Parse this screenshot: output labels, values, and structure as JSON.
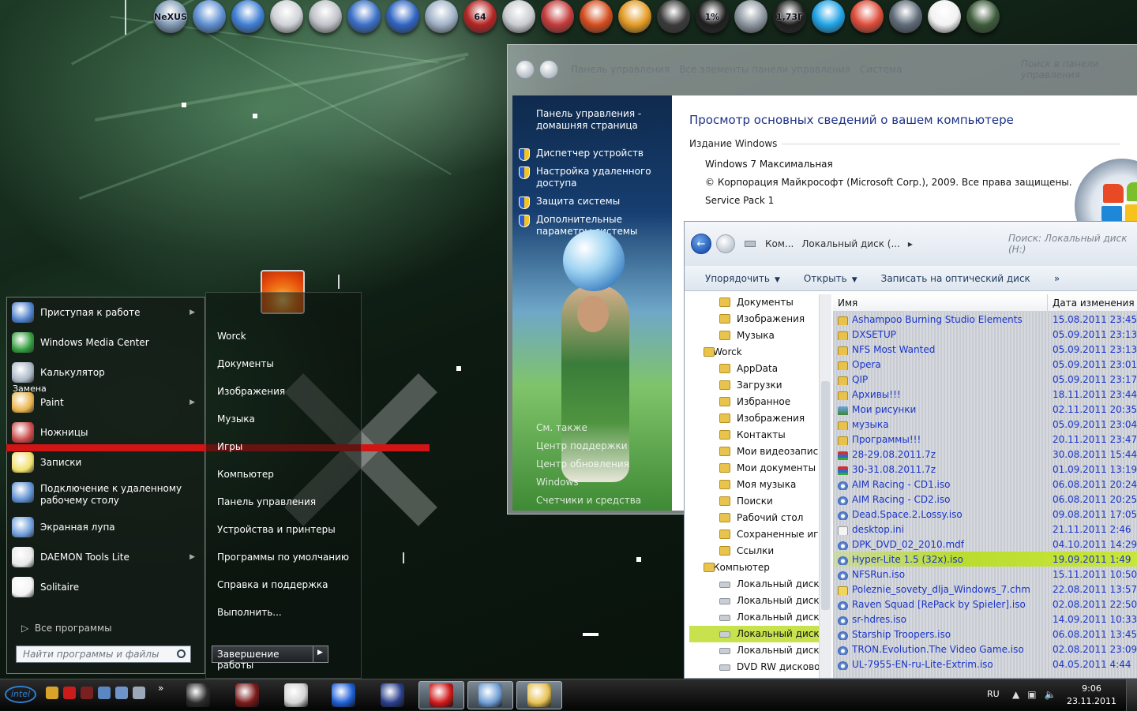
{
  "dock": {
    "items": [
      {
        "name": "nexus-icon",
        "label": "NeXUS",
        "color": "#7f9ab5"
      },
      {
        "name": "computer-icon",
        "label": "",
        "color": "#5d8fd1"
      },
      {
        "name": "windows-flag-icon",
        "label": "",
        "color": "#3f7fd4"
      },
      {
        "name": "alien-mask-icon",
        "label": "",
        "color": "#cfd2d6"
      },
      {
        "name": "clock-icon",
        "label": "",
        "color": "#bfc3c8"
      },
      {
        "name": "x-app-icon",
        "label": "",
        "color": "#3a6fc7"
      },
      {
        "name": "lightning-icon",
        "label": "",
        "color": "#2f64c2"
      },
      {
        "name": "recycle-bin-icon",
        "label": "",
        "color": "#9fb1c6"
      },
      {
        "name": "aida64-icon",
        "label": "64",
        "color": "#b52424"
      },
      {
        "name": "printer-icon",
        "label": "",
        "color": "#c9ccd0"
      },
      {
        "name": "tools-icon",
        "label": "",
        "color": "#c43a3a"
      },
      {
        "name": "ccleaner-icon",
        "label": "",
        "color": "#d44c1d"
      },
      {
        "name": "gear-icon",
        "label": "",
        "color": "#e39a22"
      },
      {
        "name": "film-reel-icon",
        "label": "",
        "color": "#3a3a3a"
      },
      {
        "name": "cpu-meter-icon",
        "label": "1%",
        "color": "#1e1e1e"
      },
      {
        "name": "network-icon",
        "label": "",
        "color": "#8c959e"
      },
      {
        "name": "memory-meter-icon",
        "label": "1,73Г",
        "color": "#1e1e1e"
      },
      {
        "name": "skype-icon",
        "label": "",
        "color": "#1fa3e6"
      },
      {
        "name": "chrome-icon",
        "label": "",
        "color": "#dd4b39"
      },
      {
        "name": "globe-icon",
        "label": "",
        "color": "#5e6a78"
      },
      {
        "name": "document-icon",
        "label": "",
        "color": "#f2f2f2"
      },
      {
        "name": "camera-icon",
        "label": "",
        "color": "#3c5a3a"
      }
    ]
  },
  "control_panel": {
    "breadcrumb": [
      "Панель управления",
      "Все элементы панели управления",
      "Система"
    ],
    "search_placeholder": "Поиск в панели управления",
    "sidebar": {
      "home": "Панель управления - домашняя страница",
      "links": [
        "Диспетчер устройств",
        "Настройка удаленного доступа",
        "Защита системы",
        "Дополнительные параметры системы"
      ],
      "see_also": [
        "См. также",
        "Центр поддержки",
        "Центр обновления Windows",
        "Счетчики и средства производительности"
      ]
    },
    "heading": "Просмотр основных сведений о вашем компьютере",
    "edition_section": "Издание Windows",
    "edition_lines": [
      "Windows 7 Максимальная",
      "© Корпорация Майкрософт (Microsoft Corp.), 2009. Все права защищены.",
      "Service Pack 1"
    ]
  },
  "explorer": {
    "address": [
      "Ком...",
      "Локальный диск (...",
      ""
    ],
    "search_placeholder": "Поиск: Локальный диск (H:)",
    "toolbar": {
      "organize": "Упорядочить",
      "open": "Открыть",
      "burn": "Записать на оптический диск"
    },
    "columns": {
      "name": "Имя",
      "date": "Дата изменения"
    },
    "tree": [
      {
        "label": "Документы",
        "level": 1,
        "type": "folder"
      },
      {
        "label": "Изображения",
        "level": 1,
        "type": "folder"
      },
      {
        "label": "Музыка",
        "level": 1,
        "type": "folder"
      },
      {
        "label": "Worck",
        "level": 0,
        "type": "folder"
      },
      {
        "label": "AppData",
        "level": 1,
        "type": "folder"
      },
      {
        "label": "Загрузки",
        "level": 1,
        "type": "folder"
      },
      {
        "label": "Избранное",
        "level": 1,
        "type": "folder"
      },
      {
        "label": "Изображения",
        "level": 1,
        "type": "folder"
      },
      {
        "label": "Контакты",
        "level": 1,
        "type": "folder"
      },
      {
        "label": "Мои видеозаписи",
        "level": 1,
        "type": "folder"
      },
      {
        "label": "Мои документы",
        "level": 1,
        "type": "folder"
      },
      {
        "label": "Моя музыка",
        "level": 1,
        "type": "folder"
      },
      {
        "label": "Поиски",
        "level": 1,
        "type": "folder"
      },
      {
        "label": "Рабочий стол",
        "level": 1,
        "type": "folder"
      },
      {
        "label": "Сохраненные игры",
        "level": 1,
        "type": "folder"
      },
      {
        "label": "Ссылки",
        "level": 1,
        "type": "folder"
      },
      {
        "label": "Компьютер",
        "level": 0,
        "type": "computer"
      },
      {
        "label": "Локальный диск (C:)",
        "level": 1,
        "type": "drive"
      },
      {
        "label": "Локальный диск (D:)",
        "level": 1,
        "type": "drive"
      },
      {
        "label": "Локальный диск (E:)",
        "level": 1,
        "type": "drive"
      },
      {
        "label": "Локальный диск (H:)",
        "level": 1,
        "type": "drive",
        "selected": true
      },
      {
        "label": "Локальный диск (G:)",
        "level": 1,
        "type": "drive"
      },
      {
        "label": "DVD RW дисковод",
        "level": 1,
        "type": "drive"
      }
    ],
    "files": [
      {
        "name": "Ashampoo Burning Studio Elements",
        "date": "15.08.2011 23:45",
        "type": "folder"
      },
      {
        "name": "DXSETUP",
        "date": "05.09.2011 23:13",
        "type": "folder"
      },
      {
        "name": "NFS Most Wanted",
        "date": "05.09.2011 23:13",
        "type": "folder"
      },
      {
        "name": "Opera",
        "date": "05.09.2011 23:01",
        "type": "folder"
      },
      {
        "name": "QIP",
        "date": "05.09.2011 23:17",
        "type": "folder"
      },
      {
        "name": "Архивы!!!",
        "date": "18.11.2011 23:44",
        "type": "folder"
      },
      {
        "name": "Мои рисунки",
        "date": "02.11.2011 20:35",
        "type": "img"
      },
      {
        "name": "музыка",
        "date": "05.09.2011 23:04",
        "type": "folder"
      },
      {
        "name": "Программы!!!",
        "date": "20.11.2011 23:47",
        "type": "folder"
      },
      {
        "name": "28-29.08.2011.7z",
        "date": "30.08.2011 15:44",
        "type": "archive"
      },
      {
        "name": "30-31.08.2011.7z",
        "date": "01.09.2011 13:19",
        "type": "archive"
      },
      {
        "name": "AIM Racing - CD1.iso",
        "date": "06.08.2011 20:24",
        "type": "iso"
      },
      {
        "name": "AIM Racing - CD2.iso",
        "date": "06.08.2011 20:25",
        "type": "iso"
      },
      {
        "name": "Dead.Space.2.Lossy.iso",
        "date": "09.08.2011 17:05",
        "type": "iso"
      },
      {
        "name": "desktop.ini",
        "date": "21.11.2011 2:46",
        "type": "doc"
      },
      {
        "name": "DPK_DVD_02_2010.mdf",
        "date": "04.10.2011 14:29",
        "type": "iso"
      },
      {
        "name": "Hyper-Lite 1.5 (32x).iso",
        "date": "19.09.2011 1:49",
        "type": "iso",
        "highlight": true
      },
      {
        "name": "NFSRun.iso",
        "date": "15.11.2011 10:50",
        "type": "iso"
      },
      {
        "name": "Poleznie_sovety_dlja_Windows_7.chm",
        "date": "22.08.2011 13:57",
        "type": "chm"
      },
      {
        "name": "Raven Squad [RePack by Spieler].iso",
        "date": "02.08.2011 22:50",
        "type": "iso"
      },
      {
        "name": "sr-hdres.iso",
        "date": "14.09.2011 10:33",
        "type": "iso"
      },
      {
        "name": "Starship Troopers.iso",
        "date": "06.08.2011 13:45",
        "type": "iso"
      },
      {
        "name": "TRON.Evolution.The Video Game.iso",
        "date": "02.08.2011 23:09",
        "type": "iso"
      },
      {
        "name": "UL-7955-EN-ru-Lite-Extrim.iso",
        "date": "04.05.2011 4:44",
        "type": "iso"
      }
    ]
  },
  "start_menu": {
    "programs": [
      {
        "label": "Приступая к работе",
        "icon": "getting-started-icon",
        "color": "#4a7fc9",
        "arrow": true
      },
      {
        "label": "Windows Media Center",
        "icon": "media-center-icon",
        "color": "#2f9a3a",
        "arrow": false
      },
      {
        "label": "Калькулятор",
        "icon": "calculator-icon",
        "color": "#a9b6c4",
        "arrow": false
      },
      {
        "label": "Paint",
        "icon": "paint-icon",
        "color": "#e9b24a",
        "arrow": true
      },
      {
        "label": "Ножницы",
        "icon": "scissors-icon",
        "color": "#c94646",
        "arrow": false
      },
      {
        "label": "Записки",
        "icon": "sticky-notes-icon",
        "color": "#f1e06a",
        "arrow": false
      },
      {
        "label": "Подключение к удаленному рабочему столу",
        "icon": "remote-desktop-icon",
        "color": "#5a8ecf",
        "arrow": false
      },
      {
        "label": "Экранная лупа",
        "icon": "magnifier-icon",
        "color": "#6a9bd8",
        "arrow": false
      },
      {
        "label": "DAEMON Tools Lite",
        "icon": "daemon-tools-icon",
        "color": "#e8e8e8",
        "arrow": true
      },
      {
        "label": "Solitaire",
        "icon": "solitaire-icon",
        "color": "#f3f3f3",
        "arrow": false
      }
    ],
    "replace_label": "Замена",
    "all_programs": "Все программы",
    "search_placeholder": "Найти программы и файлы",
    "places": [
      "Worck",
      "Документы",
      "Изображения",
      "Музыка",
      "Игры",
      "Компьютер",
      "Панель управления",
      "Устройства и принтеры",
      "Программы по умолчанию",
      "Справка и поддержка",
      "Выполнить..."
    ],
    "shutdown": "Завершение работы"
  },
  "taskbar": {
    "intel": "intel",
    "tray_left": [
      {
        "name": "settings-tray-icon",
        "color": "#d8a32b"
      },
      {
        "name": "opera-tray-icon",
        "color": "#cc1b1b"
      },
      {
        "name": "res-tray-icon",
        "color": "#7a2020"
      },
      {
        "name": "window-tray-icon",
        "color": "#5a86c2"
      },
      {
        "name": "monitor-tray-icon",
        "color": "#6f95c8"
      },
      {
        "name": "network-tray-icon",
        "color": "#9aa8b8"
      }
    ],
    "tray_expander": "»",
    "tasks": [
      {
        "name": "windows-task-icon",
        "color": "#2b2b2b",
        "active": false
      },
      {
        "name": "game-task-icon",
        "color": "#7b1a1a",
        "active": false
      },
      {
        "name": "alien-task-icon",
        "color": "#d5d5d5",
        "active": false
      },
      {
        "name": "upload-task-icon",
        "color": "#1f5fd6",
        "active": false
      },
      {
        "name": "two-panel-task-icon",
        "color": "#2a3f8c",
        "active": false
      },
      {
        "name": "opera-task-icon",
        "color": "#d11a1a",
        "active": true
      },
      {
        "name": "control-panel-task-icon",
        "color": "#6f9fd6",
        "active": true
      },
      {
        "name": "explorer-task-icon",
        "color": "#e7c256",
        "active": true
      }
    ],
    "lang": "RU",
    "time": "9:06",
    "date": "23.11.2011"
  }
}
